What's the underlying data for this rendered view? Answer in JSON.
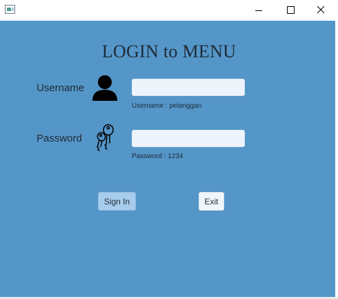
{
  "window": {
    "icon": "java-app-icon",
    "controls": {
      "minimize": "minimize-icon",
      "maximize": "maximize-icon",
      "close": "close-icon"
    }
  },
  "login": {
    "title": "LOGIN to MENU",
    "username_label": "Username",
    "username_icon": "user-icon",
    "username_value": "",
    "username_hint": "Username : pelanggan",
    "password_label": "Password",
    "password_icon": "key-icon",
    "password_value": "",
    "password_hint": "Password : 1234",
    "signin_label": "Sign In",
    "exit_label": "Exit"
  },
  "colors": {
    "background": "#5596c8",
    "field": "#eef4fb",
    "signin_button": "#a8cdec",
    "exit_button": "#f1f6fb",
    "text": "#1e2a36"
  }
}
